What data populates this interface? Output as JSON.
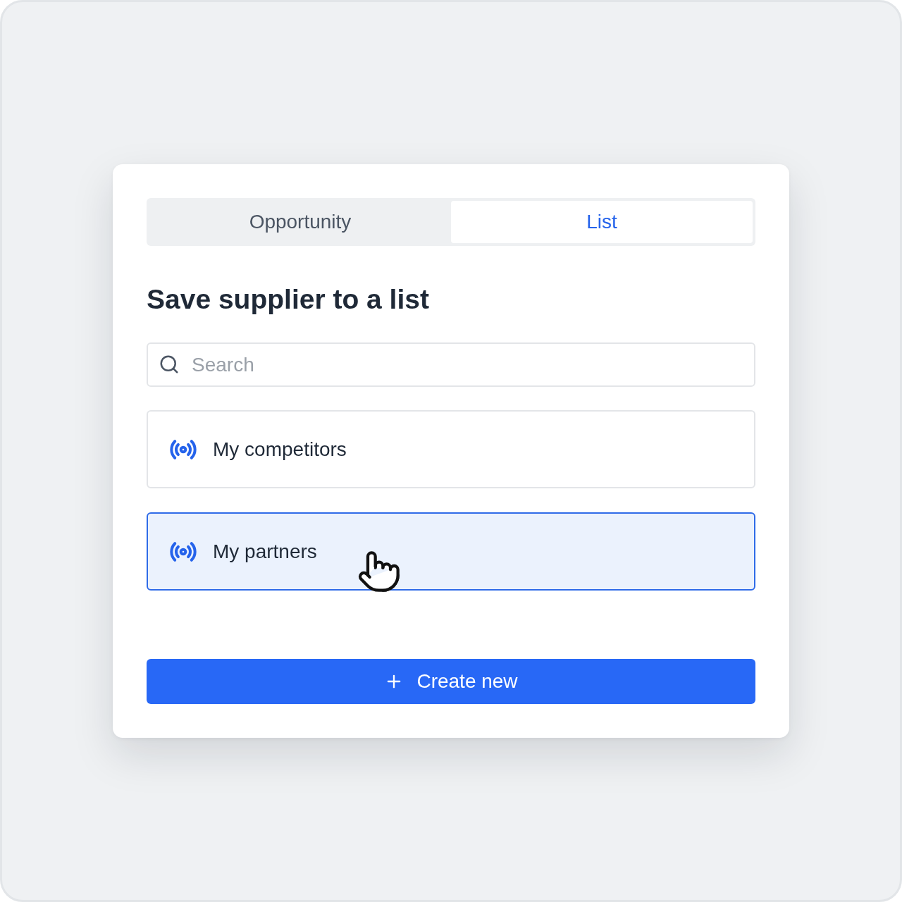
{
  "tabs": [
    {
      "label": "Opportunity",
      "selected": false
    },
    {
      "label": "List",
      "selected": true
    }
  ],
  "title": "Save supplier to a list",
  "search": {
    "placeholder": "Search"
  },
  "lists": [
    {
      "name": "My competitors",
      "selected": false,
      "hovered": false
    },
    {
      "name": "My partners",
      "selected": true,
      "hovered": true
    }
  ],
  "create_button": {
    "label": "Create new"
  }
}
